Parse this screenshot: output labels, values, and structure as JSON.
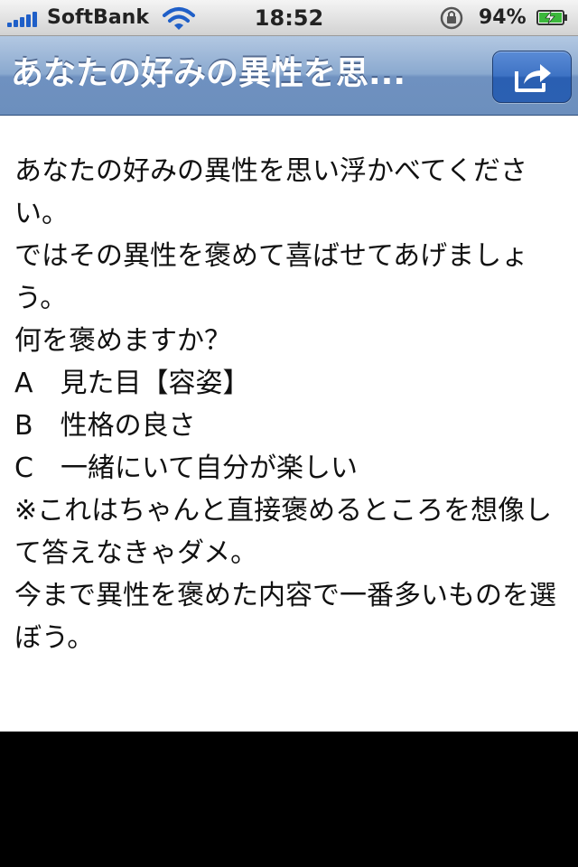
{
  "status_bar": {
    "carrier": "SoftBank",
    "time": "18:52",
    "battery_percent": "94%",
    "signal_bars": 5,
    "icons": [
      "signal-icon",
      "wifi-icon",
      "rotation-lock-icon",
      "battery-charging-icon"
    ]
  },
  "nav_bar": {
    "title": "あなたの好みの異性を思...",
    "share_icon": "share-icon"
  },
  "content": {
    "body": "あなたの好みの異性を思い浮かべてください。\nではその異性を褒めて喜ばせてあげましょう。\n何を褒めますか？\nA　見た目【容姿】\nB　性格の良さ\nC　一緒にいて自分が楽しい\n※これはちゃんと直接褒めるところを想像して答えなきゃダメ。\n今まで異性を褒めた内容で一番多いものを選ぼう。"
  },
  "colors": {
    "nav_bar": "#7e9fca",
    "share_button": "#3a6fc0",
    "signal": "#1f5fc8",
    "battery_charge": "#3cb83c",
    "content_background": "#ffffff",
    "text": "#111111"
  }
}
